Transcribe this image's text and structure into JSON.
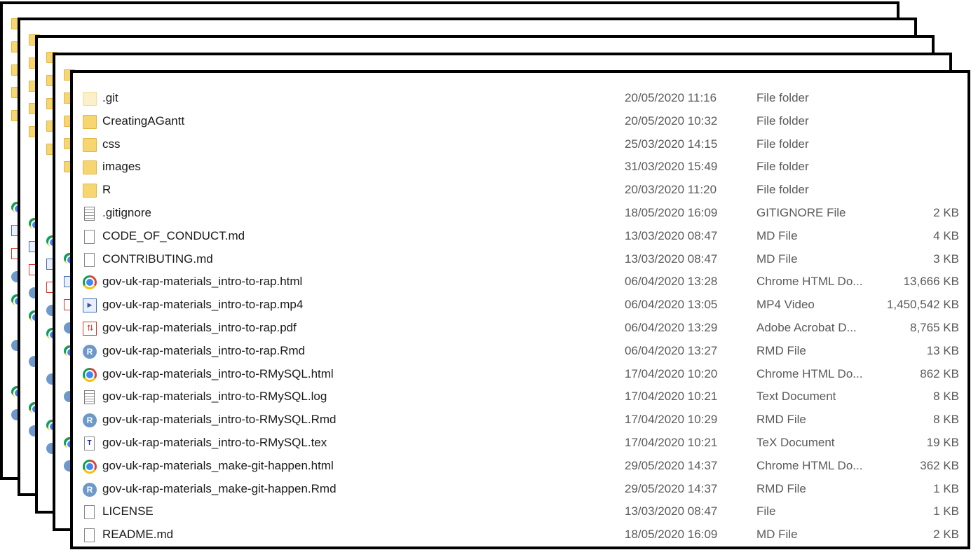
{
  "front_window": {
    "rows": [
      {
        "name": ".git",
        "date": "20/05/2020 11:16",
        "type": "File folder",
        "size": "",
        "icon": "folder-hidden-icon"
      },
      {
        "name": "CreatingAGantt",
        "date": "20/05/2020 10:32",
        "type": "File folder",
        "size": "",
        "icon": "folder-icon"
      },
      {
        "name": "css",
        "date": "25/03/2020 14:15",
        "type": "File folder",
        "size": "",
        "icon": "folder-icon"
      },
      {
        "name": "images",
        "date": "31/03/2020 15:49",
        "type": "File folder",
        "size": "",
        "icon": "folder-icon"
      },
      {
        "name": "R",
        "date": "20/03/2020 11:20",
        "type": "File folder",
        "size": "",
        "icon": "folder-icon"
      },
      {
        "name": ".gitignore",
        "date": "18/05/2020 16:09",
        "type": "GITIGNORE File",
        "size": "2 KB",
        "icon": "text-file-icon"
      },
      {
        "name": "CODE_OF_CONDUCT.md",
        "date": "13/03/2020 08:47",
        "type": "MD File",
        "size": "4 KB",
        "icon": "file-icon"
      },
      {
        "name": "CONTRIBUTING.md",
        "date": "13/03/2020 08:47",
        "type": "MD File",
        "size": "3 KB",
        "icon": "file-icon"
      },
      {
        "name": "gov-uk-rap-materials_intro-to-rap.html",
        "date": "06/04/2020 13:28",
        "type": "Chrome HTML Do...",
        "size": "13,666 KB",
        "icon": "chrome-icon"
      },
      {
        "name": "gov-uk-rap-materials_intro-to-rap.mp4",
        "date": "06/04/2020 13:05",
        "type": "MP4 Video",
        "size": "1,450,542 KB",
        "icon": "video-file-icon"
      },
      {
        "name": "gov-uk-rap-materials_intro-to-rap.pdf",
        "date": "06/04/2020 13:29",
        "type": "Adobe Acrobat D...",
        "size": "8,765 KB",
        "icon": "pdf-icon"
      },
      {
        "name": "gov-uk-rap-materials_intro-to-rap.Rmd",
        "date": "06/04/2020 13:27",
        "type": "RMD File",
        "size": "13 KB",
        "icon": "r-file-icon"
      },
      {
        "name": "gov-uk-rap-materials_intro-to-RMySQL.html",
        "date": "17/04/2020 10:20",
        "type": "Chrome HTML Do...",
        "size": "862 KB",
        "icon": "chrome-icon"
      },
      {
        "name": "gov-uk-rap-materials_intro-to-RMySQL.log",
        "date": "17/04/2020 10:21",
        "type": "Text Document",
        "size": "8 KB",
        "icon": "text-file-icon"
      },
      {
        "name": "gov-uk-rap-materials_intro-to-RMySQL.Rmd",
        "date": "17/04/2020 10:29",
        "type": "RMD File",
        "size": "8 KB",
        "icon": "r-file-icon"
      },
      {
        "name": "gov-uk-rap-materials_intro-to-RMySQL.tex",
        "date": "17/04/2020 10:21",
        "type": "TeX Document",
        "size": "19 KB",
        "icon": "tex-file-icon"
      },
      {
        "name": "gov-uk-rap-materials_make-git-happen.html",
        "date": "29/05/2020 14:37",
        "type": "Chrome HTML Do...",
        "size": "362 KB",
        "icon": "chrome-icon"
      },
      {
        "name": "gov-uk-rap-materials_make-git-happen.Rmd",
        "date": "29/05/2020 14:37",
        "type": "RMD File",
        "size": "1 KB",
        "icon": "r-file-icon"
      },
      {
        "name": "LICENSE",
        "date": "13/03/2020 08:47",
        "type": "File",
        "size": "1 KB",
        "icon": "file-icon"
      },
      {
        "name": "README.md",
        "date": "18/05/2020 16:09",
        "type": "MD File",
        "size": "2 KB",
        "icon": "file-icon"
      }
    ]
  },
  "colors": {
    "folder": "#f7d671",
    "border": "#000000",
    "text": "#1a1a1a",
    "secondary_text": "#5a5a5a"
  }
}
